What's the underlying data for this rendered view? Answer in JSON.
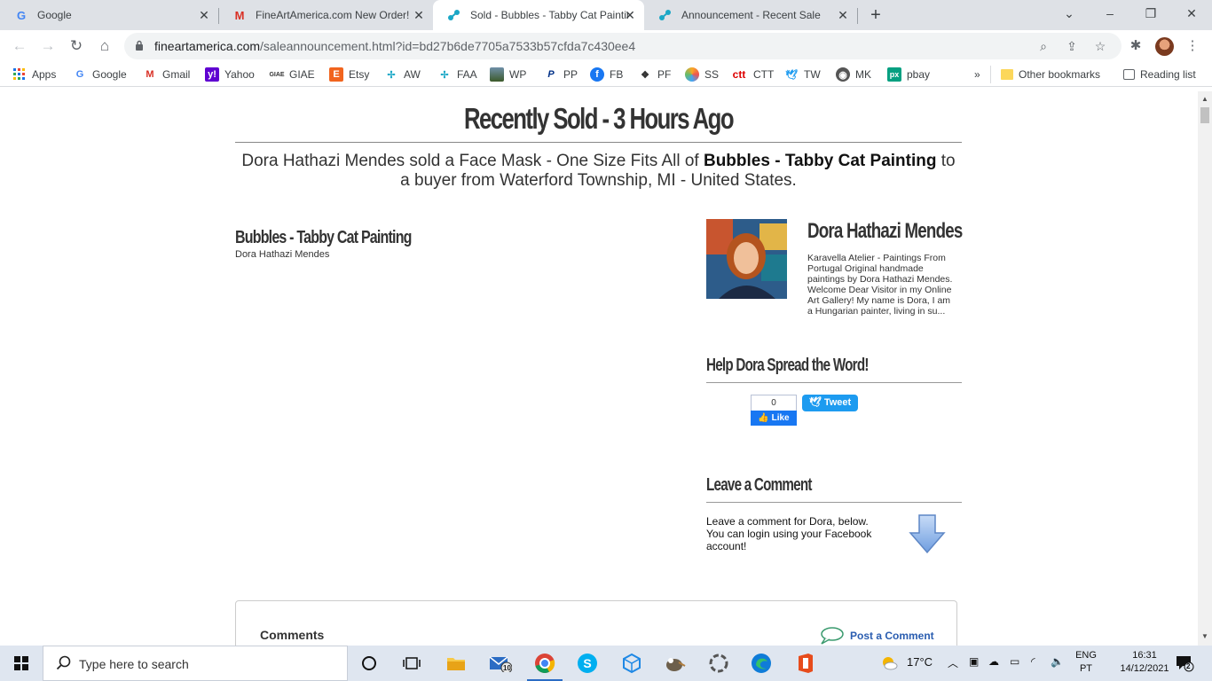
{
  "tabs": [
    {
      "title": "Google",
      "icon": "google-icon"
    },
    {
      "title": "FineArtAmerica.com New Order!",
      "icon": "gmail-icon"
    },
    {
      "title": "Sold - Bubbles - Tabby Cat Painting",
      "icon": "faa-icon",
      "active": true
    },
    {
      "title": "Announcement - Recent Sale",
      "icon": "faa-icon"
    }
  ],
  "toolbar": {
    "url_host": "fineartamerica.com",
    "url_path": "/saleannouncement.html?id=bd27b6de7705a7533b57cfda7c430ee4"
  },
  "bookmarks": [
    {
      "label": "Apps",
      "icon": "apps-grid-icon"
    },
    {
      "label": "Google",
      "icon": "google-icon"
    },
    {
      "label": "Gmail",
      "icon": "gmail-icon"
    },
    {
      "label": "Yahoo",
      "icon": "yahoo-icon"
    },
    {
      "label": "GIAE",
      "icon": "giae-icon"
    },
    {
      "label": "Etsy",
      "icon": "etsy-icon"
    },
    {
      "label": "AW",
      "icon": "faa-icon"
    },
    {
      "label": "FAA",
      "icon": "faa-icon"
    },
    {
      "label": "WP",
      "icon": "wp-icon"
    },
    {
      "label": "PP",
      "icon": "paypal-icon"
    },
    {
      "label": "FB",
      "icon": "facebook-icon"
    },
    {
      "label": "PF",
      "icon": "pf-icon"
    },
    {
      "label": "SS",
      "icon": "ss-icon"
    },
    {
      "label": "CTT",
      "icon": "ctt-icon"
    },
    {
      "label": "TW",
      "icon": "twitter-icon"
    },
    {
      "label": "MK",
      "icon": "mk-icon"
    },
    {
      "label": "pbay",
      "icon": "px-icon"
    }
  ],
  "bookmarks_right": {
    "more": "»",
    "other": "Other bookmarks",
    "reading": "Reading list"
  },
  "page": {
    "headline": "Recently Sold - 3 Hours Ago",
    "sentence_pre": "Dora Hathazi Mendes sold a Face Mask - One Size Fits All of ",
    "sentence_bold": "Bubbles - Tabby Cat Painting",
    "sentence_post": " to a buyer from Waterford Township, MI - United States.",
    "art_title": "Bubbles - Tabby Cat Painting",
    "art_artist": "Dora Hathazi Mendes",
    "artist_name": "Dora Hathazi Mendes",
    "artist_bio": "Karavella Atelier - Paintings From Portugal Original handmade paintings by Dora Hathazi Mendes. Welcome Dear Visitor in my Online Art Gallery! My name is Dora, I am a Hungarian painter, living in su...",
    "spread_heading": "Help Dora Spread the Word!",
    "like_count": "0",
    "like_label": "Like",
    "tweet_label": "Tweet",
    "leave_heading": "Leave a Comment",
    "leave_text": "Leave a comment for Dora, below.   You can login using your Facebook account!",
    "comments_title": "Comments",
    "post_comment": "Post a Comment"
  },
  "taskbar": {
    "search_placeholder": "Type here to search",
    "mail_badge": "10",
    "weather": "17°C",
    "lang_top": "ENG",
    "lang_bottom": "PT",
    "time": "16:31",
    "date": "14/12/2021",
    "notif_count": "2"
  }
}
